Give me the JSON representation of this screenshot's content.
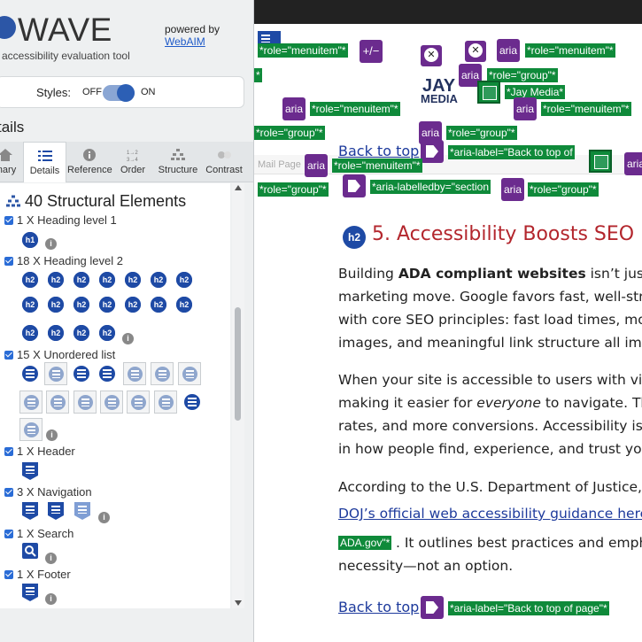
{
  "panel": {
    "logo_text": "WAVE",
    "tagline": "accessibility evaluation tool",
    "powered_by": "powered by",
    "powered_link": "WebAIM",
    "styles_label": "Styles:",
    "styles_off": "OFF",
    "styles_on": "ON",
    "details_title": "tails",
    "tabs": [
      {
        "label": "mary",
        "icon": "home-icon"
      },
      {
        "label": "Details",
        "icon": "list-icon"
      },
      {
        "label": "Reference",
        "icon": "info-icon"
      },
      {
        "label": "Order",
        "icon": "order-icon"
      },
      {
        "label": "Structure",
        "icon": "structure-icon"
      },
      {
        "label": "Contrast",
        "icon": "contrast-icon"
      }
    ],
    "active_tab": "Details",
    "category_title": "40 Structural Elements",
    "groups": [
      {
        "label": "1 X Heading level 1"
      },
      {
        "label": "18 X Heading level 2"
      },
      {
        "label": "15 X Unordered list"
      },
      {
        "label": "1 X Header"
      },
      {
        "label": "3 X Navigation"
      },
      {
        "label": "1 X Search"
      },
      {
        "label": "1 X Footer"
      }
    ],
    "h1_badge": "h1",
    "h2_badge": "h2",
    "info_glyph": "i"
  },
  "page": {
    "tags": {
      "role_menuitem": "*role=\"menuitem\"*",
      "star": "*",
      "role_group": "*role=\"group\"*",
      "jay_media": "*Jay Media*",
      "back_to_top_of": "*aria-label=\"Back to top of",
      "labelledby": "*aria-labelledby=\"section",
      "ada_gov": "ADA.gov\"*",
      "back_to_top_page": "*aria-label=\"Back to top of page\"*"
    },
    "aria_badge": "aria",
    "plus_minus": "+/−",
    "logo_jay": "JAY",
    "logo_media": "MEDIA",
    "back_to_top": "Back to top",
    "h2_icon": "h2",
    "heading": "5. Accessibility Boosts SEO",
    "p1": [
      {
        "pre": "Building ",
        "bold": "ADA compliant websites",
        "post": " isn’t just a"
      },
      {
        "text": "marketing move. Google favors fast, well-stru"
      },
      {
        "text": "with core SEO principles: fast load times, mo"
      },
      {
        "text": "images, and meaningful link structure all imp"
      }
    ],
    "p2": [
      {
        "text": "When your site is accessible to users with vis"
      },
      {
        "pre": "making it easier for ",
        "em": "everyone",
        "post": " to navigate. Tha"
      },
      {
        "text": "rates, and more conversions. Accessibility is"
      },
      {
        "text": "in how people find, experience, and trust you"
      }
    ],
    "p3_line1": "According to the U.S. Department of Justice,",
    "p3_link": "DOJ’s official web accessibility guidance here",
    "p3_line3": ". It outlines best practices and empha",
    "p3_line4": "necessity—not an option.",
    "nav_faint": "Mail Page"
  }
}
